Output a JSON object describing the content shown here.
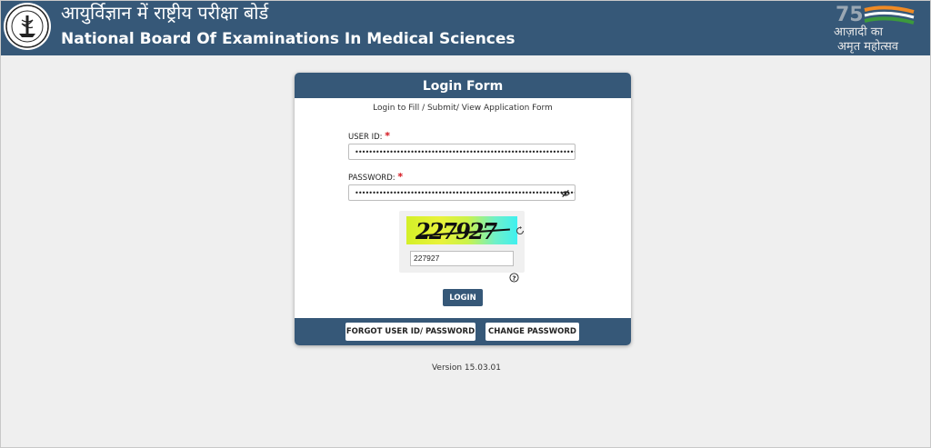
{
  "header": {
    "hindi_title": "आयुर्विज्ञान में राष्ट्रीय परीक्षा बोर्ड",
    "english_title": "National Board Of Examinations In Medical Sciences",
    "azadi_logo": {
      "line1": "आज़ादी का",
      "line2": "अमृत महोत्सव",
      "number": "75"
    }
  },
  "login_form": {
    "title": "Login Form",
    "subtitle": "Login to Fill / Submit/ View Application Form",
    "user_id_label": "USER ID:",
    "user_id_value": "••••••••••••••••••••••••••••••••••••••••••••••••••••••••••••••••••••••••••••",
    "password_label": "PASSWORD:",
    "password_value": "••••••••••••••••••••••••••••••••••••••••••••••••••••••••••••••••••••••••••••",
    "required_mark": "*",
    "captcha_image_text": "227927",
    "captcha_input_value": "227927",
    "login_button": "LOGIN",
    "forgot_button": "FORGOT USER ID/ PASSWORD",
    "change_password_button": "CHANGE PASSWORD"
  },
  "footer": {
    "version": "Version 15.03.01"
  },
  "colors": {
    "primary": "#365878",
    "required": "#d4121b",
    "background": "#efefef"
  }
}
